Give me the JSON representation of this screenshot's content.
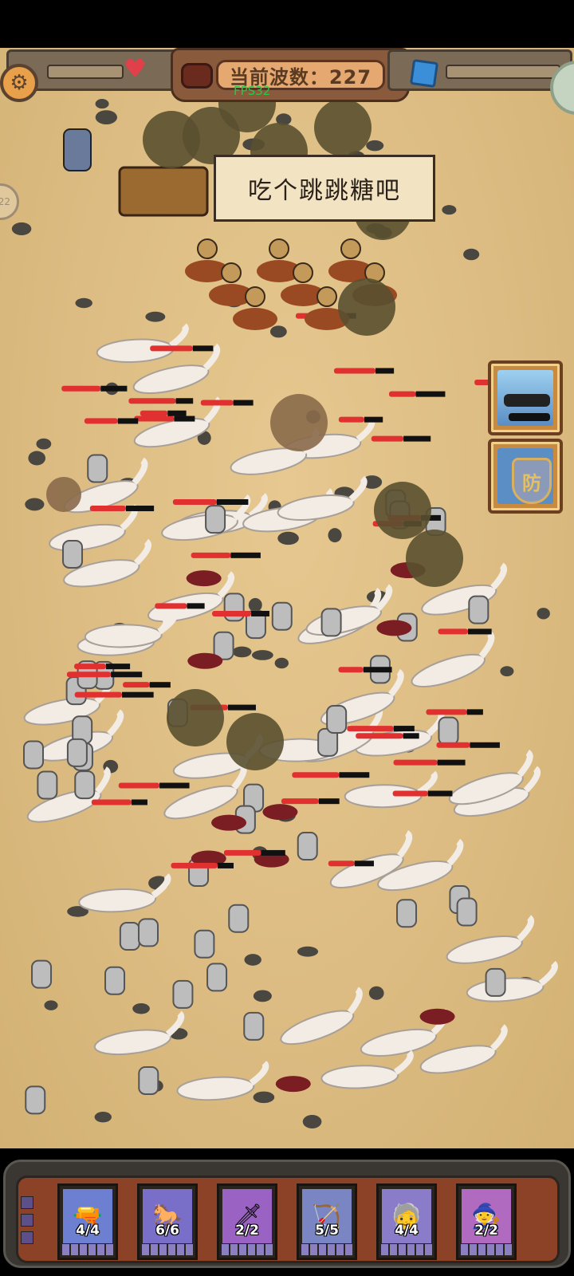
{
  "hud": {
    "wave_label": "当前波数：227",
    "fps": "FPS32",
    "side_counter": "22"
  },
  "speech_bubble": "吃个跳跳糖吧",
  "skills": [
    {
      "name": "barrage-skill",
      "label": ""
    },
    {
      "name": "defense-skill",
      "label": "防"
    }
  ],
  "units": [
    {
      "name": "gunner",
      "count": "4/4",
      "icon": "gunner-icon",
      "bg": "#6d7fd0"
    },
    {
      "name": "cavalry",
      "count": "6/6",
      "icon": "cavalry-icon",
      "bg": "#7a6fc8"
    },
    {
      "name": "assassin",
      "count": "2/2",
      "icon": "assassin-icon",
      "bg": "#9a62c2"
    },
    {
      "name": "ballista",
      "count": "5/5",
      "icon": "ballista-icon",
      "bg": "#7a86c4"
    },
    {
      "name": "monk",
      "count": "4/4",
      "icon": "monk-icon",
      "bg": "#8a7cc8"
    },
    {
      "name": "wizard",
      "count": "2/2",
      "icon": "wizard-icon",
      "bg": "#b06ac0"
    }
  ],
  "colors": {
    "ground": "#dcbc82",
    "wolf": "#f2ece4",
    "soldier": "#bdbdbd",
    "smoke": "#5a5030",
    "hp_bar": "#e03030"
  }
}
